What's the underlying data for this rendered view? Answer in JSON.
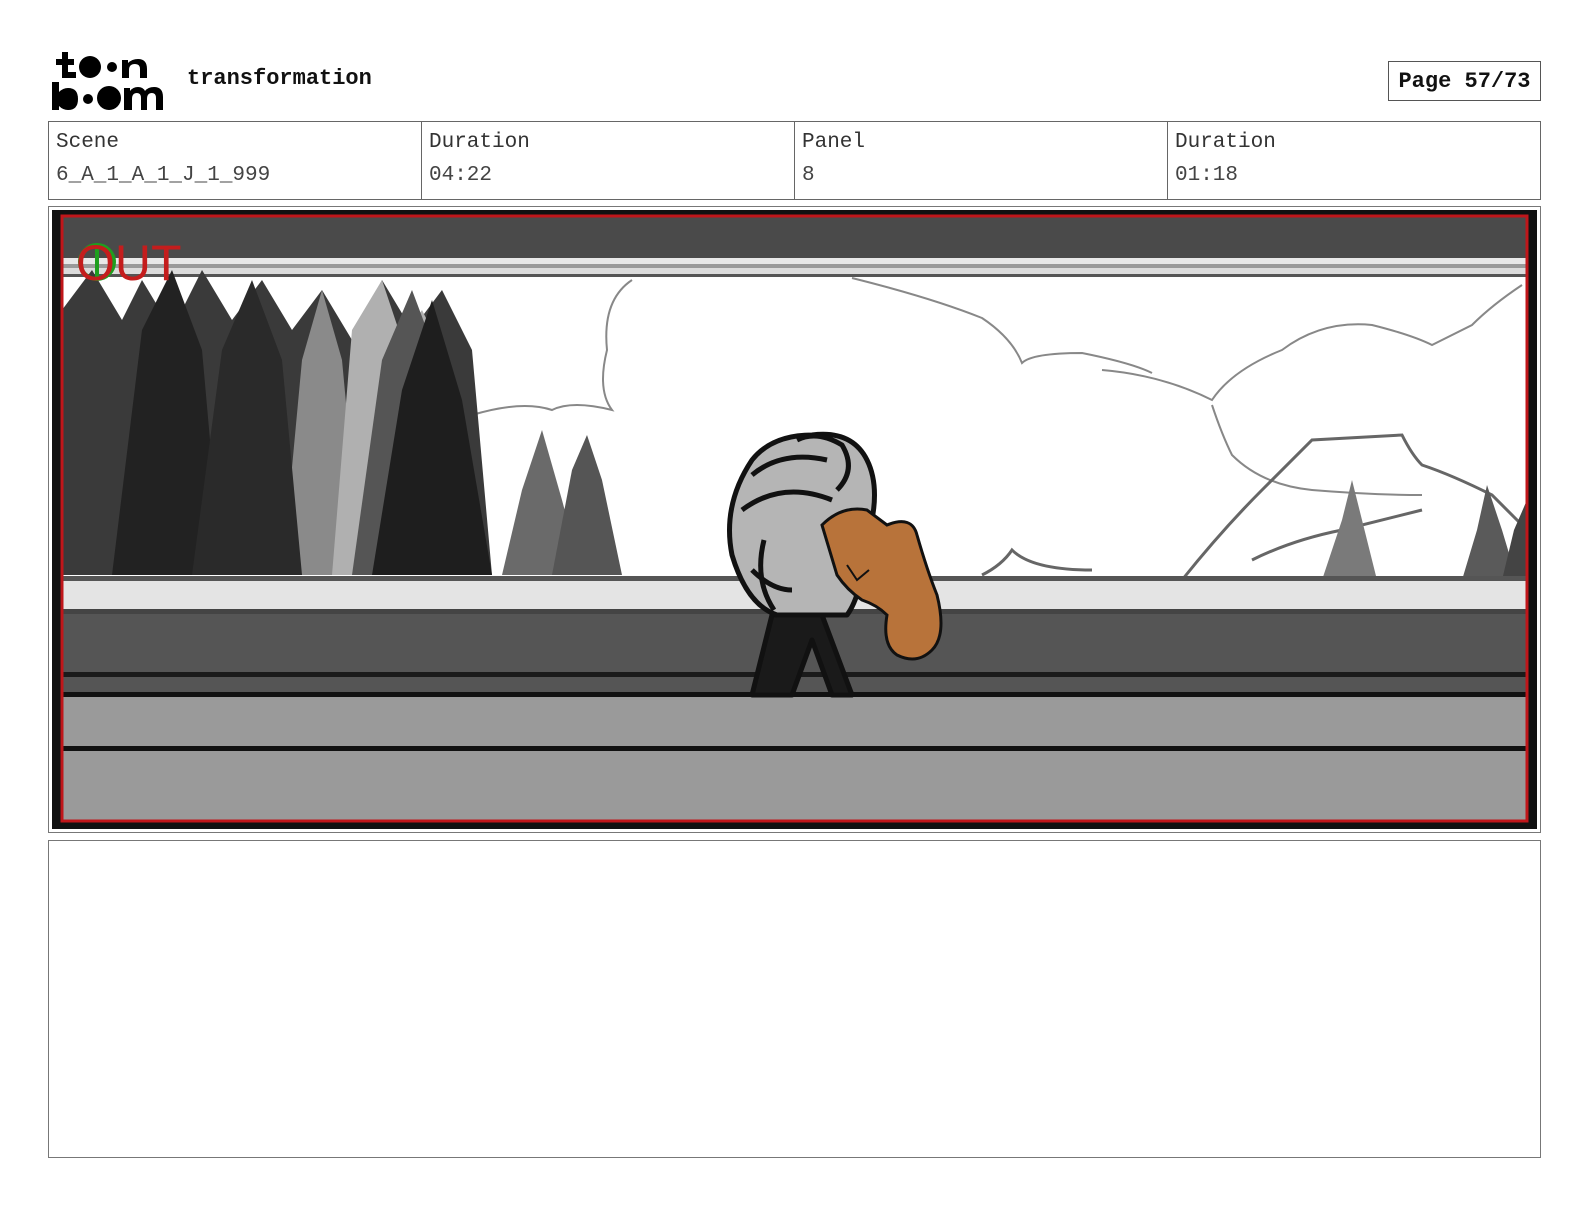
{
  "header": {
    "logo_icon": "toonboom-logo",
    "project_title": "transformation",
    "page_label": "Page 57/73"
  },
  "info": {
    "scene_label": "Scene",
    "scene_value": "6_A_1_A_1_J_1_999",
    "scene_duration_label": "Duration",
    "scene_duration_value": "04:22",
    "panel_label": "Panel",
    "panel_value": "8",
    "panel_duration_label": "Duration",
    "panel_duration_value": "01:18"
  },
  "panel": {
    "overlay_text": "OUT",
    "overlay_color": "#c41d1d",
    "marker_color": "#1f9e1f",
    "frame_color": "#c0161a",
    "fox_color": "#b8733a"
  },
  "notes": {
    "text": ""
  }
}
